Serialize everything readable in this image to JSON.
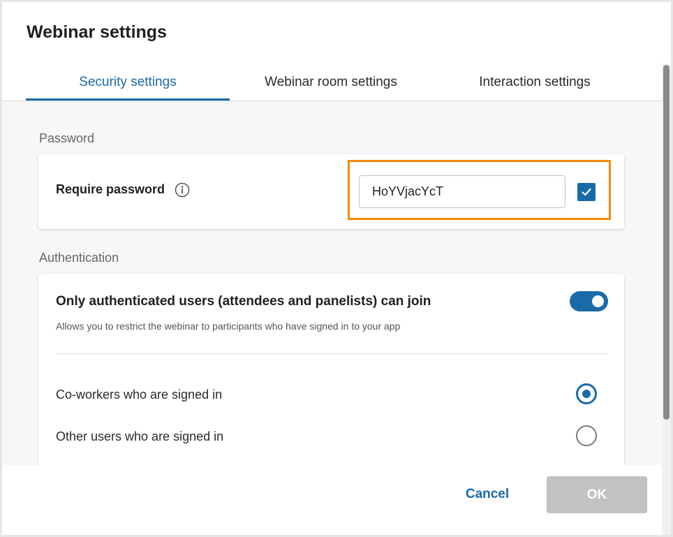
{
  "dialog": {
    "title": "Webinar settings"
  },
  "tabs": [
    {
      "label": "Security settings",
      "active": true
    },
    {
      "label": "Webinar room settings",
      "active": false
    },
    {
      "label": "Interaction settings",
      "active": false
    }
  ],
  "password_section": {
    "heading": "Password",
    "require_label": "Require password",
    "info_icon": "info-icon",
    "password_value": "HoYVjacYcT",
    "require_checked": true,
    "highlight_color": "#f18a06"
  },
  "auth_section": {
    "heading": "Authentication",
    "only_auth_title": "Only authenticated users (attendees and panelists) can join",
    "only_auth_desc": "Allows you to restrict the webinar to participants who have signed in to your app",
    "toggle_on": true,
    "options": [
      {
        "label": "Co-workers who are signed in",
        "selected": true
      },
      {
        "label": "Other users who are signed in",
        "selected": false
      }
    ]
  },
  "footer": {
    "cancel_label": "Cancel",
    "ok_label": "OK"
  },
  "colors": {
    "accent": "#1a6aa8",
    "disabled": "#c2c2c2"
  }
}
